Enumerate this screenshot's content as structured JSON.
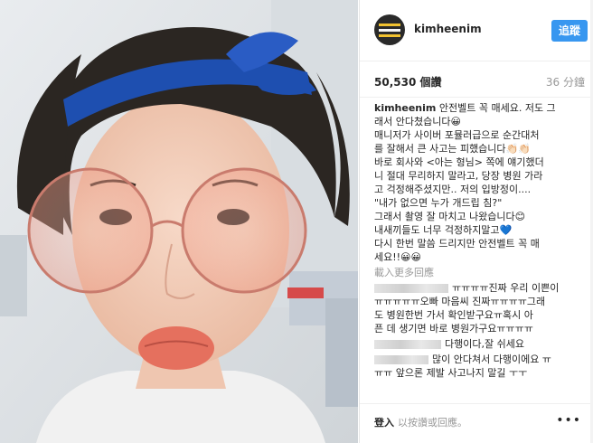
{
  "post": {
    "username": "kimheenim",
    "follow_label": "追蹤",
    "views": "50,530 個讚",
    "time": "36 分鐘",
    "caption_lines": [
      "안전벨트 꼭 매세요. 저도 그",
      "래서 안다쳤습니다😀",
      "매니저가 사이버 포뮬러급으로 순간대처",
      "를 잘해서 큰 사고는 피했습니다👏🏻👏🏻",
      "바로 회사와 <아는 형님> 쪽에 얘기했더",
      "니 절대 무리하지 말라고, 당장 병원 가라",
      "고 걱정해주셨지만.. 저의 입방정이....",
      "\"내가 없으면 누가 개드립 침?\"",
      "그래서 촬영 잘 마치고 나왔습니다😊",
      "내새끼들도 너무 걱정하지말고💙",
      "다시 한번 말씀 드리지만 안전벨트 꼭 매",
      "세요!!😀😀"
    ],
    "load_more": "載入更多回應",
    "comments": [
      {
        "lines": [
          "ㅠㅠㅠㅠ진짜 우리 이쁜이",
          "ㅠㅠㅠㅠㅠ오빠 마음씨 진짜ㅠㅠㅠㅠ그래",
          "도 병원한번 가서 확인받구요ㅠ혹시 아",
          "픈 데 생기면 바로 병원가구요ㅠㅠㅠㅠ"
        ],
        "blur_width": 82
      },
      {
        "lines": [
          "다행이다,잘 쉬세요"
        ],
        "blur_width": 74
      },
      {
        "lines": [
          "많이 안다쳐서 다행이에요 ㅠ",
          "ㅠㅠ 앞으론 제발 사고나지 말길 ㅜㅜ"
        ],
        "blur_width": 60
      }
    ],
    "footer": {
      "login_label": "登入",
      "login_text": "以按讚或回應。",
      "more_icon": "•••"
    }
  }
}
